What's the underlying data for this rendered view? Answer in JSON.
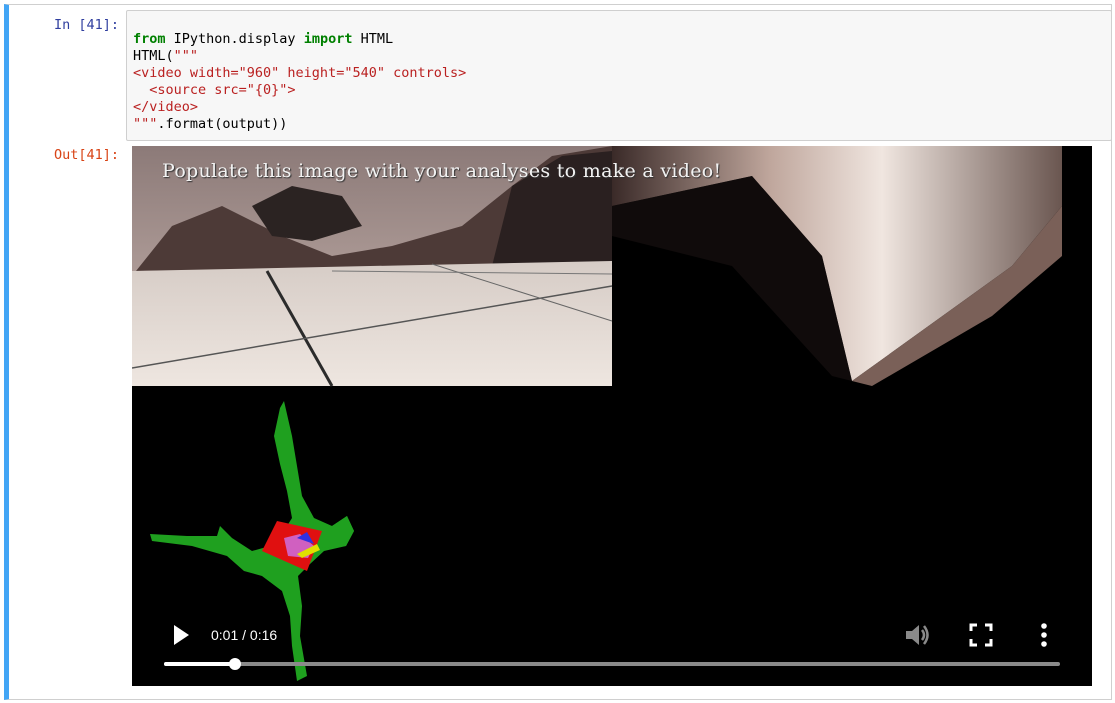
{
  "cell": {
    "in_prompt": "In [41]:",
    "out_prompt": "Out[41]:",
    "code": {
      "line1_kw1": "from",
      "line1_mid": " IPython.display ",
      "line1_kw2": "import",
      "line1_end": " HTML",
      "line2_plain": "HTML(",
      "line2_str": "\"\"\"",
      "line3": "<video width=\"960\" height=\"540\" controls>",
      "line4": "  <source src=\"{0}\">",
      "line5": "</video>",
      "line6_str": "\"\"\"",
      "line6_plain": ".format(output))"
    }
  },
  "video": {
    "overlay_text": "Populate this image with your analyses to make a video!",
    "current_time": "0:01",
    "duration": "0:16",
    "time_display": "0:01 / 0:16",
    "progress_fraction": 0.0797,
    "icons": {
      "play": "play-icon",
      "volume": "volume-icon",
      "fullscreen": "fullscreen-icon",
      "more": "more-options-icon"
    }
  },
  "colors": {
    "cell_accent": "#42a5f5",
    "in_prompt": "#303f9f",
    "out_prompt": "#d84315",
    "keyword": "#008000",
    "string": "#ba2121",
    "map_terrain": "#1fa01f",
    "rover_marker": "#e01010"
  }
}
